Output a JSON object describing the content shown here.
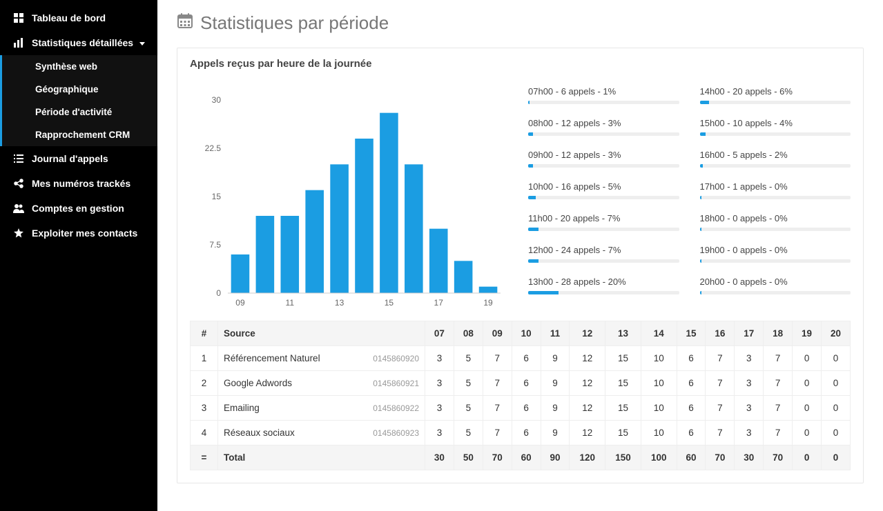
{
  "sidebar": {
    "items": [
      {
        "label": "Tableau de bord",
        "icon": "dashboard-icon"
      },
      {
        "label": "Statistiques détaillées",
        "icon": "stats-icon",
        "expanded": true,
        "children": [
          {
            "label": "Synthèse web"
          },
          {
            "label": "Géographique"
          },
          {
            "label": "Période d'activité"
          },
          {
            "label": "Rapprochement CRM"
          }
        ]
      },
      {
        "label": "Journal d'appels",
        "icon": "list-icon"
      },
      {
        "label": "Mes numéros trackés",
        "icon": "share-icon"
      },
      {
        "label": "Comptes en gestion",
        "icon": "users-icon"
      },
      {
        "label": "Exploiter mes contacts",
        "icon": "star-icon"
      }
    ]
  },
  "page": {
    "title": "Statistiques par période",
    "panel_title": "Appels reçus par heure de la journée"
  },
  "chart_data": {
    "type": "bar",
    "categories": [
      "09",
      "10",
      "11",
      "12",
      "13",
      "14",
      "15",
      "16",
      "17",
      "18",
      "19"
    ],
    "x_tick_labels": [
      "09",
      "11",
      "13",
      "15",
      "17",
      "19"
    ],
    "values": [
      6,
      12,
      12,
      16,
      20,
      24,
      28,
      20,
      10,
      5,
      1
    ],
    "y_ticks": [
      0,
      7.5,
      15,
      22.5,
      30
    ],
    "ylim": [
      0,
      30
    ],
    "title": "Appels reçus par heure de la journée",
    "xlabel": "",
    "ylabel": ""
  },
  "hour_summary": {
    "col1": [
      {
        "label": "07h00 - 6 appels - 1%",
        "pct": 1
      },
      {
        "label": "08h00 - 12 appels - 3%",
        "pct": 3
      },
      {
        "label": "09h00 - 12 appels - 3%",
        "pct": 3
      },
      {
        "label": "10h00 - 16 appels - 5%",
        "pct": 5
      },
      {
        "label": "11h00 - 20 appels - 7%",
        "pct": 7
      },
      {
        "label": "12h00 - 24 appels - 7%",
        "pct": 7
      },
      {
        "label": "13h00 - 28 appels - 20%",
        "pct": 20
      }
    ],
    "col2": [
      {
        "label": "14h00 - 20 appels - 6%",
        "pct": 6
      },
      {
        "label": "15h00 - 10 appels - 4%",
        "pct": 4
      },
      {
        "label": "16h00 - 5 appels - 2%",
        "pct": 2
      },
      {
        "label": "17h00 - 1 appels - 0%",
        "pct": 0
      },
      {
        "label": "18h00 - 0 appels - 0%",
        "pct": 0
      },
      {
        "label": "19h00 - 0 appels - 0%",
        "pct": 0
      },
      {
        "label": "20h00 - 0 appels - 0%",
        "pct": 0
      }
    ]
  },
  "table": {
    "headers": [
      "#",
      "Source",
      "07",
      "08",
      "09",
      "10",
      "11",
      "12",
      "13",
      "14",
      "15",
      "16",
      "17",
      "18",
      "19",
      "20"
    ],
    "rows": [
      {
        "num": "1",
        "source": "Référencement Naturel",
        "phone": "0145860920",
        "cells": [
          "3",
          "5",
          "7",
          "6",
          "9",
          "12",
          "15",
          "10",
          "6",
          "7",
          "3",
          "7",
          "0",
          "0"
        ]
      },
      {
        "num": "2",
        "source": "Google Adwords",
        "phone": "0145860921",
        "cells": [
          "3",
          "5",
          "7",
          "6",
          "9",
          "12",
          "15",
          "10",
          "6",
          "7",
          "3",
          "7",
          "0",
          "0"
        ]
      },
      {
        "num": "3",
        "source": "Emailing",
        "phone": "0145860922",
        "cells": [
          "3",
          "5",
          "7",
          "6",
          "9",
          "12",
          "15",
          "10",
          "6",
          "7",
          "3",
          "7",
          "0",
          "0"
        ]
      },
      {
        "num": "4",
        "source": "Réseaux sociaux",
        "phone": "0145860923",
        "cells": [
          "3",
          "5",
          "7",
          "6",
          "9",
          "12",
          "15",
          "10",
          "6",
          "7",
          "3",
          "7",
          "0",
          "0"
        ]
      }
    ],
    "total": {
      "label": "Total",
      "num": "=",
      "cells": [
        "30",
        "50",
        "70",
        "60",
        "90",
        "120",
        "150",
        "100",
        "60",
        "70",
        "30",
        "70",
        "0",
        "0"
      ]
    }
  }
}
